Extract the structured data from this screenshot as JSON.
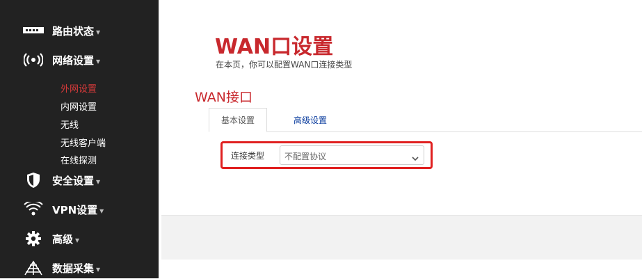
{
  "sidebar": {
    "menu": [
      {
        "label": "路由状态",
        "icon": "router-icon",
        "caret": "▾"
      },
      {
        "label": "网络设置",
        "icon": "wireless-signal-icon",
        "caret": "▾"
      },
      {
        "label": "安全设置",
        "icon": "shield-icon",
        "caret": "▾"
      },
      {
        "label": "VPN设置",
        "icon": "wifi-icon",
        "caret": "▾"
      },
      {
        "label": "高级",
        "icon": "gear-icon",
        "caret": "▾"
      },
      {
        "label": "数据采集",
        "icon": "data-collection-icon",
        "caret": "▾"
      }
    ],
    "submenu": [
      {
        "label": "外网设置",
        "active": true
      },
      {
        "label": "内网设置",
        "active": false
      },
      {
        "label": "无线",
        "active": false
      },
      {
        "label": "无线客户端",
        "active": false
      },
      {
        "label": "在线探测",
        "active": false
      }
    ]
  },
  "main": {
    "title": "WAN口设置",
    "subtitle": "在本页，你可以配置WAN口连接类型",
    "section_title": "WAN接口",
    "tabs": [
      {
        "label": "基本设置",
        "active": true
      },
      {
        "label": "高级设置",
        "active": false
      }
    ],
    "connection_type": {
      "label": "连接类型",
      "value": "不配置协议"
    }
  },
  "colors": {
    "accent": "#c8282d",
    "sidebar_bg": "#222222",
    "highlight_border": "#e02020",
    "tab_link": "#0a3c9e"
  }
}
